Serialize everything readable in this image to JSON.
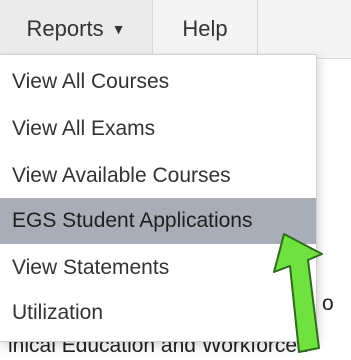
{
  "menubar": {
    "reports_label": "Reports",
    "reports_caret": "▼",
    "help_label": "Help"
  },
  "dropdown": {
    "items": [
      {
        "label": "View All Courses"
      },
      {
        "label": "View All Exams"
      },
      {
        "label": "View Available Courses"
      },
      {
        "label": "EGS Student Applications",
        "highlighted": true
      },
      {
        "label": "View Statements"
      },
      {
        "label": "Utilization"
      }
    ]
  },
  "background": {
    "partial_text": "inical Education and Workforce I",
    "fragment": "o"
  },
  "colors": {
    "menubar_bg": "#f4f4f4",
    "highlight_bg": "#a9adb8",
    "arrow_fill": "#6fe23f",
    "arrow_stroke": "#2f6b1a"
  },
  "annotation": {
    "icon": "arrow-up-left-icon"
  }
}
